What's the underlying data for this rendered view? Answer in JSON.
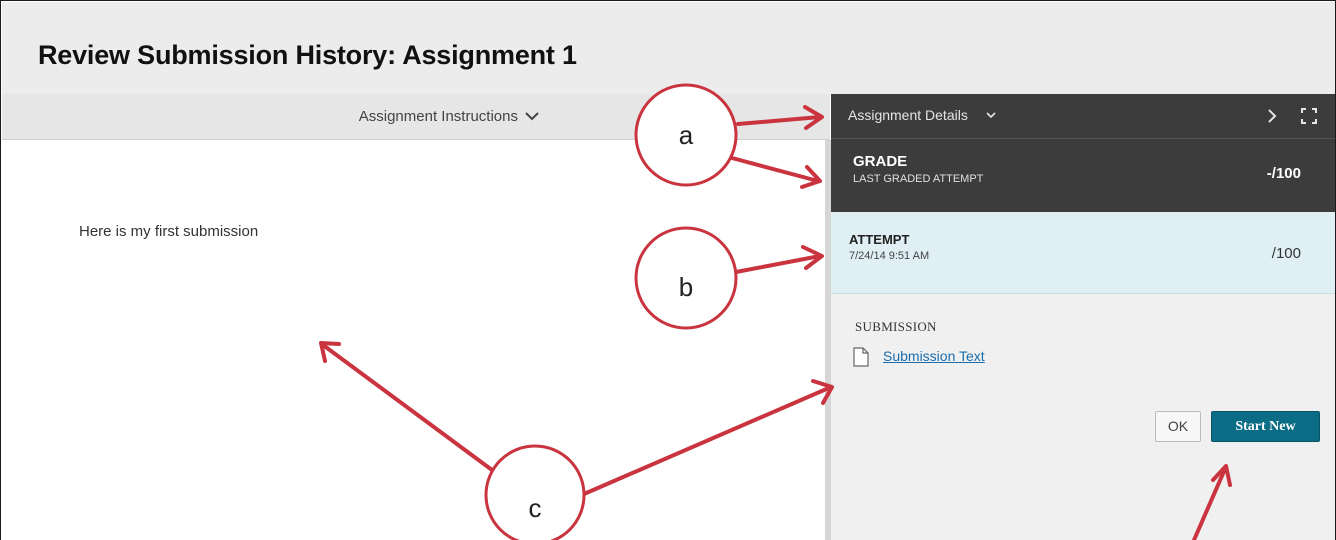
{
  "page": {
    "title": "Review Submission History: Assignment 1"
  },
  "left_panel": {
    "header_label": "Assignment Instructions",
    "body_text": "Here is my first submission"
  },
  "right_panel": {
    "header_label": "Assignment Details",
    "grade": {
      "title": "GRADE",
      "subtitle": "LAST GRADED ATTEMPT",
      "score": "-/100"
    },
    "attempt": {
      "title": "ATTEMPT",
      "date": "7/24/14 9:51 AM",
      "score": "/100"
    },
    "submission": {
      "label": "SUBMISSION",
      "link_text": "Submission Text"
    },
    "buttons": {
      "ok_label": "OK",
      "start_new_label": "Start New"
    }
  },
  "annotations": {
    "callout_a": "a",
    "callout_b": "b",
    "callout_c": "c",
    "color": "#c9343f"
  },
  "colors": {
    "dark_panel": "#3c3c3c",
    "attempt_bg": "#dfeff4",
    "link": "#1a6dac",
    "primary_button": "#0b6c85"
  }
}
